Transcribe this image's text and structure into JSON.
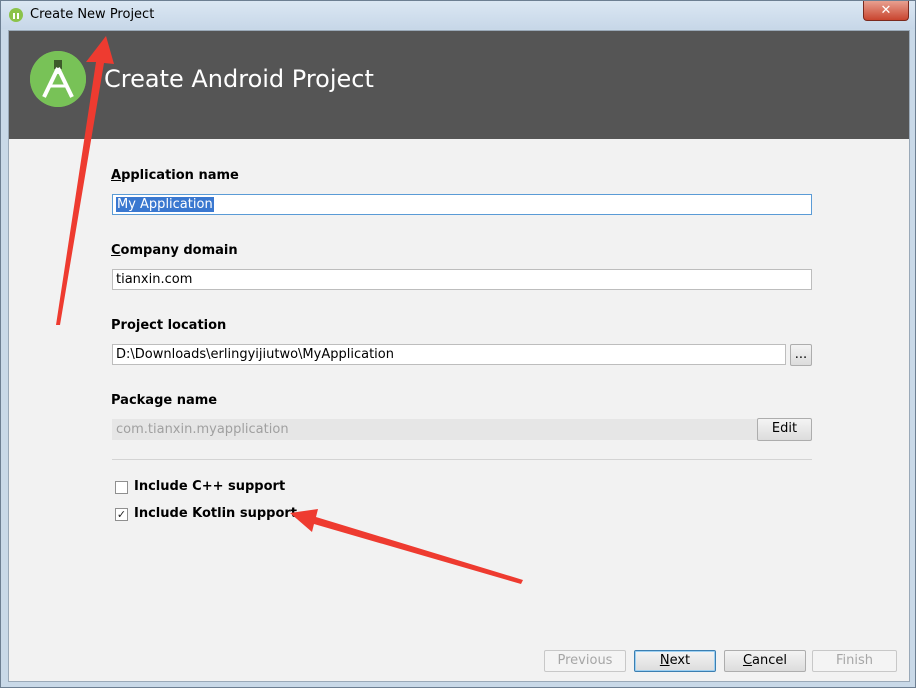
{
  "window": {
    "title": "Create New Project",
    "close_label": "✕"
  },
  "header": {
    "title": "Create Android Project"
  },
  "form": {
    "app_name_label_u": "A",
    "app_name_label_rest": "pplication name",
    "app_name_value": "My Application",
    "company_label_u": "C",
    "company_label_rest": "ompany domain",
    "company_value": "tianxin.com",
    "location_label": "Project location",
    "location_value": "D:\\Downloads\\erlingyijiutwo\\MyApplication",
    "browse_label": "...",
    "package_label": "Package name",
    "package_value": "com.tianxin.myapplication",
    "edit_label": "Edit"
  },
  "options": {
    "cpp_label": "Include C++ support",
    "cpp_checked": false,
    "kotlin_label": "Include Kotlin support",
    "kotlin_checked": true,
    "check_glyph": "✓"
  },
  "footer": {
    "previous_label": "Previous",
    "next_label_u": "N",
    "next_label_rest": "ext",
    "cancel_label_u": "C",
    "cancel_label_rest": "ancel",
    "finish_label": "Finish"
  },
  "colors": {
    "header_bg": "#555555",
    "annotation_arrow": "#ee3b30",
    "logo": "#78c257"
  }
}
